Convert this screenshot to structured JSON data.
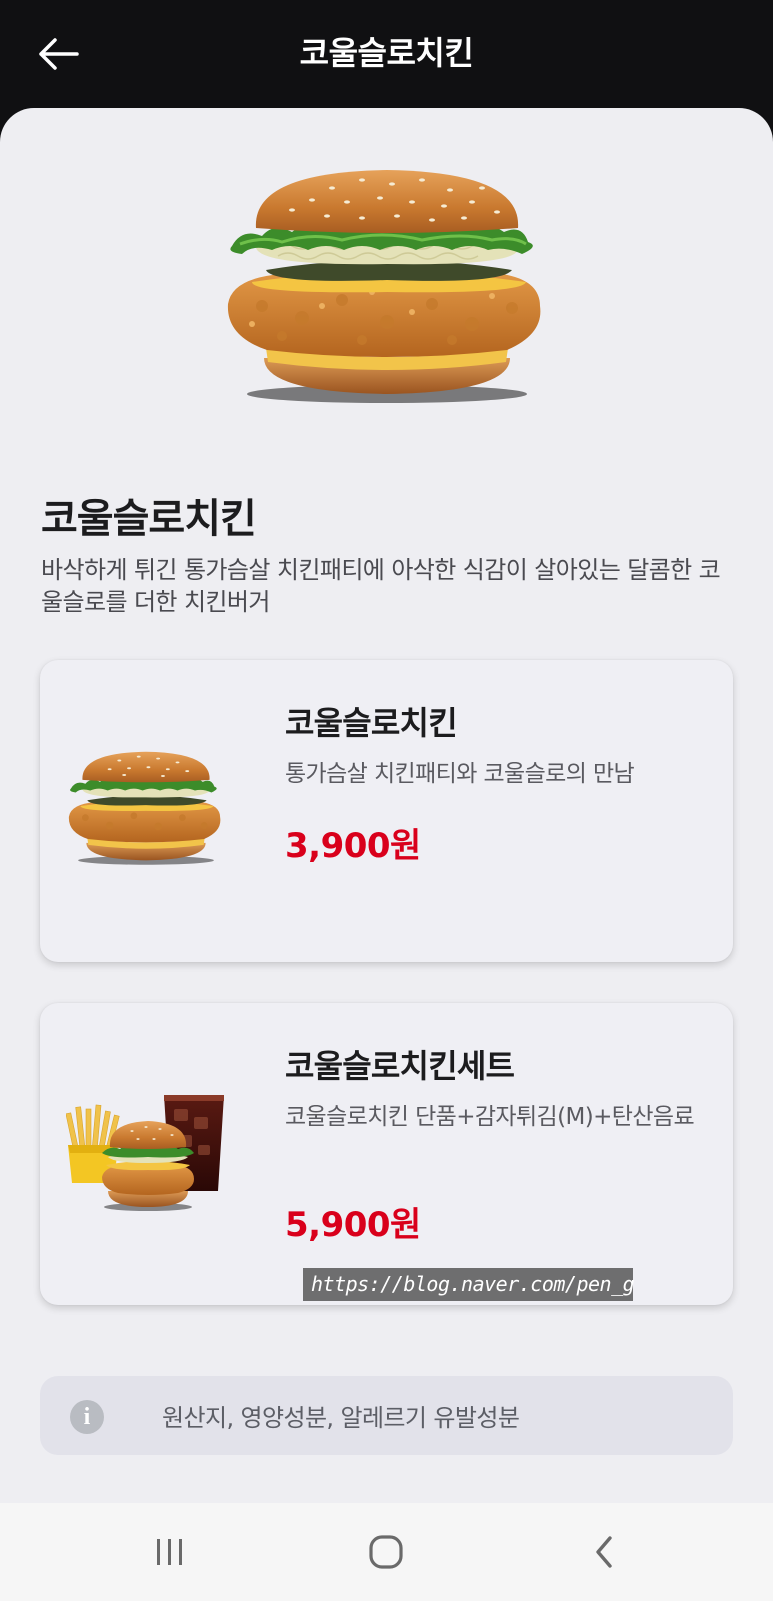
{
  "header": {
    "title": "코울슬로치킨",
    "back_icon": "arrow-left-icon"
  },
  "product": {
    "name": "코울슬로치킨",
    "description": "바삭하게 튀긴 통가슴살 치킨패티에 아삭한 식감이 살아있는 달콤한 코울슬로를 더한 치킨버거"
  },
  "options": [
    {
      "name": "코울슬로치킨",
      "subtitle": "통가슴살 치킨패티와 코울슬로의 만남",
      "price": "3,900원"
    },
    {
      "name": "코울슬로치킨세트",
      "subtitle": "코울슬로치킨 단품+감자튀김(M)+탄산음료",
      "price": "5,900원"
    }
  ],
  "watermark": "https://blog.naver.com/pen_g",
  "info": {
    "icon": "info-icon",
    "label": "원산지, 영양성분, 알레르기 유발성분"
  },
  "navbar": {
    "recent_icon": "recent-apps-icon",
    "home_icon": "home-icon",
    "back_icon": "back-chevron-icon"
  },
  "colors": {
    "header_bg": "#101012",
    "sheet_bg": "#eeeef2",
    "price": "#d9001b"
  }
}
